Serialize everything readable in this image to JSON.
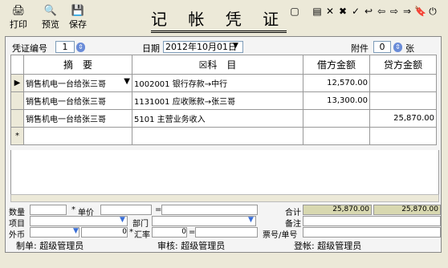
{
  "toolbar": {
    "print": "打印",
    "preview": "预览",
    "save": "保存"
  },
  "title": "记 帐 凭 证",
  "header": {
    "voucher_no_label": "凭证编号",
    "voucher_no": "1",
    "date_label": "日期",
    "date": "2012年10月01日",
    "attach_label": "附件",
    "attach": "0",
    "attach_unit": "张"
  },
  "columns": {
    "summary": "摘　要",
    "subject": "科　目",
    "debit": "借方金额",
    "credit": "贷方金额"
  },
  "rows": [
    {
      "summary": "销售机电一台给张三哥",
      "subject": "1002001 银行存款→中行",
      "debit": "12,570.00",
      "credit": ""
    },
    {
      "summary": "销售机电一台给张三哥",
      "subject": "1131001 应收账款→张三哥",
      "debit": "13,300.00",
      "credit": ""
    },
    {
      "summary": "销售机电一台给张三哥",
      "subject": "5101 主营业务收入",
      "debit": "",
      "credit": "25,870.00"
    }
  ],
  "new_row_marker": "*",
  "current_row_marker": "▶",
  "bottom": {
    "qty": "数量",
    "price": "单价",
    "item": "项目",
    "dept": "部门",
    "currency": "外币",
    "rate": "汇率",
    "total": "合计",
    "total_debit": "25,870.00",
    "total_credit": "25,870.00",
    "remark": "备注",
    "ticket": "票号/单号",
    "currency_val": "0",
    "rate_val": "0",
    "star": "*",
    "eq": "="
  },
  "footer": {
    "maker": "制单: 超级管理员",
    "auditor": "审核: 超级管理员",
    "poster": "登帐: 超级管理员"
  }
}
